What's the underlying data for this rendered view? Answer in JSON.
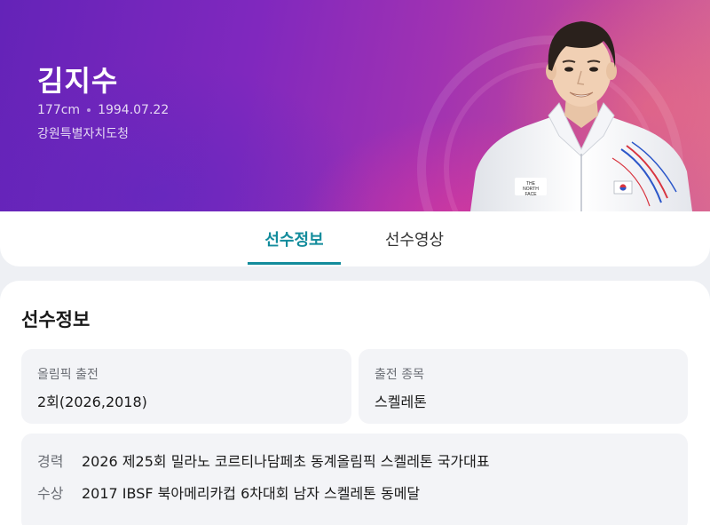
{
  "athlete": {
    "name": "김지수",
    "height": "177cm",
    "birthdate": "1994.07.22",
    "team": "강원특별자치도청"
  },
  "tabs": [
    {
      "label": "선수정보",
      "active": true
    },
    {
      "label": "선수영상",
      "active": false
    }
  ],
  "section": {
    "title": "선수정보"
  },
  "info": {
    "olympic_label": "올림픽 출전",
    "olympic_value": "2회(2026,2018)",
    "event_label": "출전 종목",
    "event_value": "스켈레톤"
  },
  "career": {
    "career_key": "경력",
    "career_text": "2026 제25회 밀라노 코르티나담페초 동계올림픽 스켈레톤 국가대표",
    "award_key": "수상",
    "award_text": "2017 IBSF 북아메리카컵 6차대회 남자 스켈레톤 동메달"
  },
  "portrait": {
    "jacket_logo": "THE NORTH FACE"
  },
  "colors": {
    "accent": "#138c9c",
    "hero_start": "#6423b8",
    "hero_end": "#d86893",
    "box_bg": "#f3f4f7"
  }
}
